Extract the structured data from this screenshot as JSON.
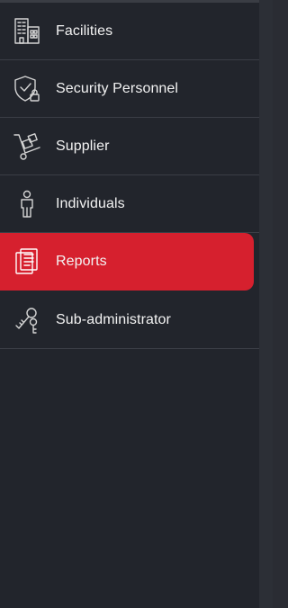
{
  "sidebar": {
    "items": [
      {
        "label": "Facilities",
        "icon": "building-icon",
        "active": false
      },
      {
        "label": "Security Personnel",
        "icon": "shield-lock-icon",
        "active": false
      },
      {
        "label": "Supplier",
        "icon": "hand-truck-icon",
        "active": false
      },
      {
        "label": "Individuals",
        "icon": "person-icon",
        "active": false
      },
      {
        "label": "Reports",
        "icon": "report-document-icon",
        "active": true
      },
      {
        "label": "Sub-administrator",
        "icon": "admin-keys-icon",
        "active": false
      }
    ]
  },
  "colors": {
    "sidebar_bg": "#22252c",
    "active_bg": "#d6202e",
    "text": "#f3f3f3",
    "divider": "#3b3e46"
  }
}
